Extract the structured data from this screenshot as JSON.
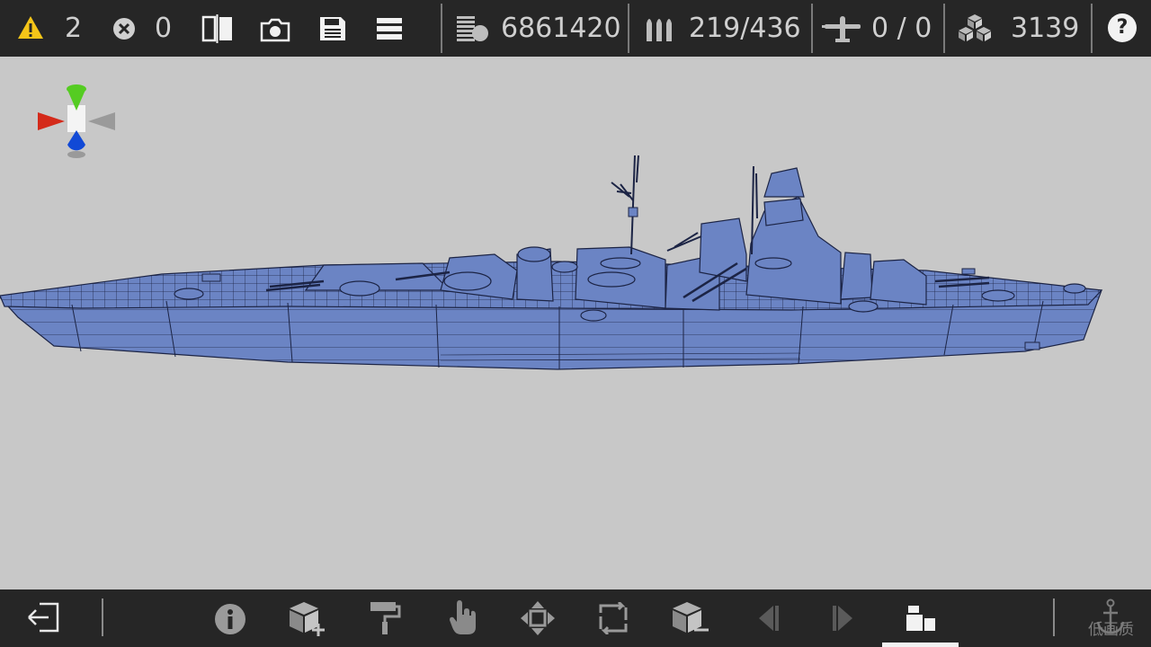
{
  "toolbar": {
    "warnings_count": "2",
    "errors_count": "0",
    "stats": {
      "weight": "6861420",
      "ammo": "219/436",
      "aircraft": "0 / 0",
      "parts": "3139"
    },
    "help_label": "?"
  },
  "icons": {
    "warning": "warning-triangle-icon",
    "error": "error-circle-icon",
    "mirror": "mirror-icon",
    "camera": "camera-icon",
    "save": "save-icon",
    "menu": "menu-icon",
    "weight": "weight-icon",
    "ammo": "ammo-icon",
    "aircraft": "aircraft-icon",
    "parts": "parts-icon",
    "help": "help-icon"
  },
  "bottom_toolbar": {
    "items": [
      "exit",
      "info",
      "add-part",
      "paint",
      "select",
      "move",
      "rotate",
      "remove-part",
      "undo",
      "redo",
      "view"
    ],
    "active_item": "view",
    "quality_label": "低画质"
  },
  "colors": {
    "bar_bg": "#262626",
    "viewport_bg": "#c8c8c8",
    "hull_fill": "#6b84c4",
    "warning": "#f5c518",
    "axis_x": "#d42a1a",
    "axis_y": "#55cc22",
    "axis_z": "#1149d6"
  }
}
